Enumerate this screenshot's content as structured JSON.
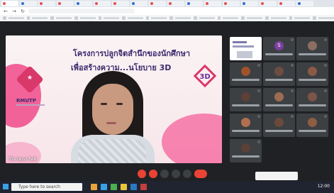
{
  "browser": {
    "tabs": [
      {
        "active": true
      },
      {
        "active": false
      },
      {
        "active": false
      },
      {
        "active": false
      },
      {
        "active": false
      },
      {
        "active": false
      },
      {
        "active": false
      },
      {
        "active": false
      },
      {
        "active": false
      },
      {
        "active": false
      },
      {
        "active": false
      },
      {
        "active": false
      },
      {
        "active": false
      },
      {
        "active": false
      },
      {
        "active": false
      },
      {
        "active": false
      },
      {
        "active": false
      }
    ]
  },
  "presentation": {
    "title_line1": "โครงการปลูกจิตสำนึกของนักศึกษา",
    "title_line2": "เพื่อสร้างความ...นโยบาย 3D",
    "brand": "RMUTP",
    "badge": "3D"
  },
  "speaker_caption": "วิไล (คุณ) กิตติ",
  "participants": [
    {
      "initial": "S",
      "color": "#7b3fa0"
    },
    {
      "initial": "",
      "color": "#8d6e63"
    },
    {
      "initial": "",
      "color": "#a0522d"
    },
    {
      "initial": "",
      "color": "#6d4c41"
    },
    {
      "initial": "",
      "color": "#8a5a44"
    },
    {
      "initial": "",
      "color": "#5d4037"
    },
    {
      "initial": "",
      "color": "#9c6b52"
    },
    {
      "initial": "",
      "color": "#7a5548"
    },
    {
      "initial": "",
      "color": "#b07050"
    },
    {
      "initial": "",
      "color": "#6b4a3a"
    },
    {
      "initial": "",
      "color": "#8e5d44"
    },
    {
      "initial": "",
      "color": "#5a4036"
    }
  ],
  "meeting_code": "",
  "taskbar": {
    "search_placeholder": "Type here to search",
    "clock": "12:00"
  },
  "colors": {
    "end_call": "#ea4335",
    "accent_pink": "#f04a8a"
  }
}
